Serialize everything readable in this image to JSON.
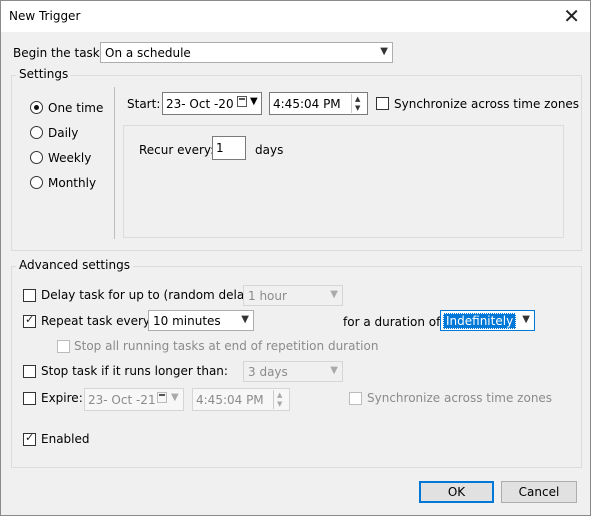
{
  "window": {
    "title": "New Trigger",
    "close_icon": "close-icon"
  },
  "begin": {
    "label": "Begin the task:",
    "value": "On a schedule"
  },
  "settings": {
    "label": "Settings",
    "schedule_options": [
      {
        "label": "One time",
        "selected": true
      },
      {
        "label": "Daily",
        "selected": false
      },
      {
        "label": "Weekly",
        "selected": false
      },
      {
        "label": "Monthly",
        "selected": false
      }
    ],
    "start_label": "Start:",
    "start_date": "23- Oct -20",
    "start_time": "4:45:04 PM",
    "sync_label": "Synchronize across time zones",
    "sync_checked": false,
    "recur_label": "Recur every:",
    "recur_value": "1",
    "recur_unit": "days"
  },
  "advanced": {
    "label": "Advanced settings",
    "delay_label": "Delay task for up to (random delay):",
    "delay_checked": false,
    "delay_value": "1 hour",
    "repeat_label": "Repeat task every:",
    "repeat_checked": true,
    "repeat_value": "10 minutes",
    "duration_label": "for a duration of:",
    "duration_value": "Indefinitely",
    "stop_running_label": "Stop all running tasks at end of repetition duration",
    "stop_running_checked": false,
    "stop_longer_label": "Stop task if it runs longer than:",
    "stop_longer_checked": false,
    "stop_longer_value": "3 days",
    "expire_label": "Expire:",
    "expire_checked": false,
    "expire_date": "23- Oct -21",
    "expire_time": "4:45:04 PM",
    "expire_sync_label": "Synchronize across time zones",
    "enabled_label": "Enabled",
    "enabled_checked": true
  },
  "buttons": {
    "ok": "OK",
    "cancel": "Cancel"
  }
}
